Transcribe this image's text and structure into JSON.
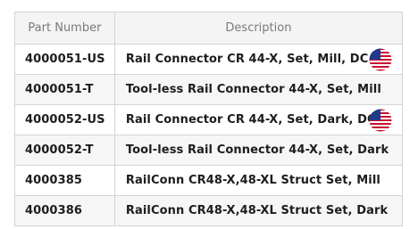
{
  "table": {
    "headers": [
      "Part Number",
      "Description"
    ],
    "rows": [
      {
        "part": "4000051-US",
        "description": "Rail Connector CR 44-X, Set, Mill, DC",
        "flag": "us-flag-icon"
      },
      {
        "part": "4000051-T",
        "description": "Tool-less Rail Connector 44-X, Set, Mill",
        "flag": null
      },
      {
        "part": "4000052-US",
        "description": "Rail Connector CR 44-X, Set, Dark, DC",
        "flag": "us-flag-icon"
      },
      {
        "part": "4000052-T",
        "description": "Tool-less Rail Connector 44-X, Set, Dark",
        "flag": null
      },
      {
        "part": "4000385",
        "description": "RailConn CR48-X,48-XL Struct Set, Mill",
        "flag": null
      },
      {
        "part": "4000386",
        "description": "RailConn CR48-X,48-XL Struct Set, Dark",
        "flag": null
      }
    ]
  },
  "colors": {
    "header_bg": "#f4f4f4",
    "alt_row_bg": "#f6f6f6",
    "border": "#d4d4d4",
    "text": "#1d1d1d",
    "header_text": "#7a7a7a"
  }
}
